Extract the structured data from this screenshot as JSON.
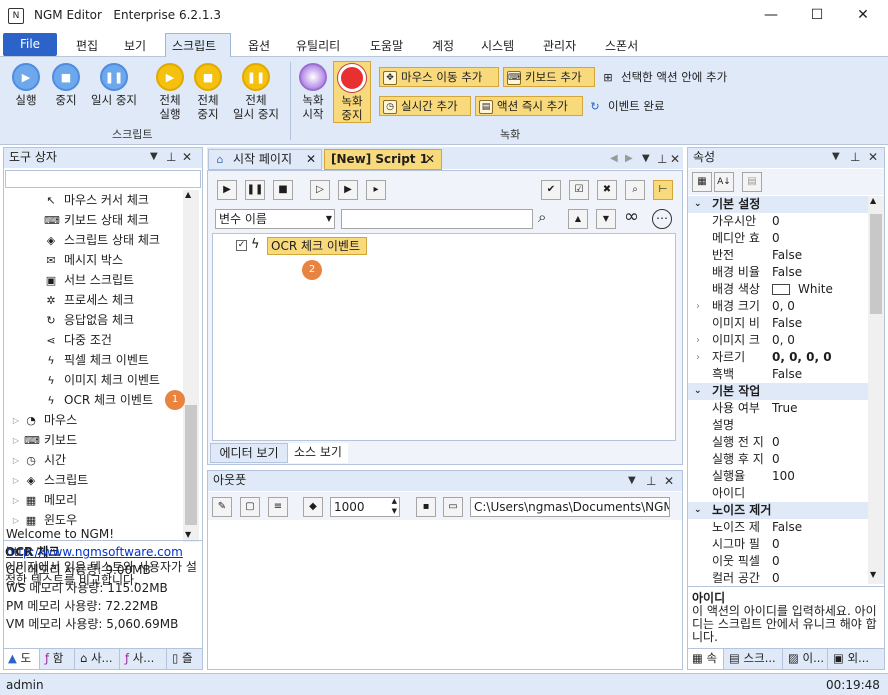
{
  "window": {
    "app_name": "NGM Editor",
    "edition": "Enterprise 6.2.1.3",
    "logo_glyph": "N",
    "minimize_glyph": "—",
    "maximize_glyph": "☐",
    "close_glyph": "✕"
  },
  "menu": {
    "file": "File",
    "items": [
      "편집",
      "보기",
      "스크립트",
      "옵션",
      "유틸리티",
      "도움말",
      "계정",
      "시스템",
      "관리자",
      "스폰서"
    ]
  },
  "ribbon": {
    "run": "실행",
    "stop": "중지",
    "pause": "일시 중지",
    "run_all": [
      "전체",
      "실행"
    ],
    "stop_all": [
      "전체",
      "중지"
    ],
    "pause_all": [
      "전체",
      "일시 중지"
    ],
    "script_group": "스크립트",
    "rec_start": [
      "녹화",
      "시작"
    ],
    "rec_stop": [
      "녹화",
      "중지"
    ],
    "add_mouse": "마우스 이동 추가",
    "add_key": "키보드 추가",
    "add_in_action": "선택한 액션 안에 추가",
    "add_realtime": "실시간 추가",
    "add_immediate": "액션 즉시 추가",
    "event_done": "이벤트 완료",
    "record_group": "녹화"
  },
  "toolbox": {
    "title": "도구 상자",
    "items": [
      {
        "icon": "cursor-check-icon",
        "glyph": "↖",
        "label": "마우스 커서 체크"
      },
      {
        "icon": "keyboard-icon",
        "glyph": "⌨",
        "label": "키보드 상태 체크"
      },
      {
        "icon": "script-status-icon",
        "glyph": "◈",
        "label": "스크립트 상태 체크"
      },
      {
        "icon": "message-icon",
        "glyph": "✉",
        "label": "메시지 박스"
      },
      {
        "icon": "sub-script-icon",
        "glyph": "▣",
        "label": "서브 스크립트"
      },
      {
        "icon": "process-icon",
        "glyph": "✲",
        "label": "프로세스 체크"
      },
      {
        "icon": "refresh-icon",
        "glyph": "↻",
        "label": "응답없음 체크"
      },
      {
        "icon": "share-icon",
        "glyph": "⋖",
        "label": "다중 조건"
      },
      {
        "icon": "lightning-icon",
        "glyph": "ϟ",
        "label": "픽셀 체크 이벤트"
      },
      {
        "icon": "lightning-icon",
        "glyph": "ϟ",
        "label": "이미지 체크 이벤트"
      },
      {
        "icon": "lightning-icon",
        "glyph": "ϟ",
        "label": "OCR 체크 이벤트"
      }
    ],
    "categories": [
      {
        "icon": "mouse-icon",
        "glyph": "◔",
        "label": "마우스"
      },
      {
        "icon": "keyboard-icon",
        "glyph": "⌨",
        "label": "키보드"
      },
      {
        "icon": "clock-icon",
        "glyph": "◷",
        "label": "시간"
      },
      {
        "icon": "script-icon",
        "glyph": "◈",
        "label": "스크립트"
      },
      {
        "icon": "memory-icon",
        "glyph": "▦",
        "label": "메모리"
      },
      {
        "icon": "windows-icon",
        "glyph": "▦",
        "label": "윈도우"
      }
    ],
    "desc_title": "OCR 체크",
    "desc_text": "이미지에서 읽은 텍스트와 사용자가 설정한 텍스트를 비교합니다.",
    "bottom_tabs": [
      "도",
      "함",
      "사...",
      "사...",
      "즐"
    ],
    "badge": "1"
  },
  "editor": {
    "tabs": [
      {
        "label": "시작 페이지"
      },
      {
        "label": "[New] Script 1"
      }
    ],
    "var_select": "변수 이름",
    "event_label": "OCR 체크 이벤트",
    "badge": "2",
    "bottom_tabs": [
      "에디터 보기",
      "소스 보기"
    ]
  },
  "output": {
    "title": "아웃풋",
    "font_size": "1000",
    "path": "C:\\Users\\ngmas\\Documents\\NGM6\\",
    "lines": [
      "Welcome to NGM!",
      "http://www.ngmsoftware.com",
      "GC 메모리 사용량: 9.00MB",
      "WS 메모리 사용량: 115.02MB",
      "PM 메모리 사용량: 72.22MB",
      "VM 메모리 사용량: 5,060.69MB"
    ]
  },
  "properties": {
    "title": "속성",
    "rows": [
      {
        "type": "section",
        "key": "기본 설정"
      },
      {
        "key": "가우시안",
        "val": "0"
      },
      {
        "key": "메디안 효",
        "val": "0"
      },
      {
        "key": "반전",
        "val": "False"
      },
      {
        "key": "배경 비율",
        "val": "False"
      },
      {
        "key": "배경 색상",
        "val": "White",
        "swatch": "#ffffff"
      },
      {
        "key": "배경 크기",
        "val": "0, 0",
        "exp": true
      },
      {
        "key": "이미지 비",
        "val": "False"
      },
      {
        "key": "이미지 크",
        "val": "0, 0",
        "exp": true
      },
      {
        "key": "자르기",
        "val": "0, 0, 0, 0",
        "exp": true,
        "bold": true
      },
      {
        "key": "흑백",
        "val": "False"
      },
      {
        "type": "section",
        "key": "기본 작업"
      },
      {
        "key": "사용 여부",
        "val": "True"
      },
      {
        "key": "설명",
        "val": ""
      },
      {
        "key": "실행 전 지",
        "val": "0"
      },
      {
        "key": "실행 후 지",
        "val": "0"
      },
      {
        "key": "실행율",
        "val": "100"
      },
      {
        "key": "아이디",
        "val": ""
      },
      {
        "type": "section",
        "key": "노이즈 제거"
      },
      {
        "key": "노이즈 제",
        "val": "False"
      },
      {
        "key": "시그마 필",
        "val": "0"
      },
      {
        "key": "이웃 픽셀",
        "val": "0"
      },
      {
        "key": "컬러 공간",
        "val": "0"
      }
    ],
    "desc_title": "아이디",
    "desc_text": "이 액션의 아이디를 입력하세요. 아이디는 스크립트 안에서 유니크 해야 합니다.",
    "bottom_tabs": [
      "속",
      "스크...",
      "이...",
      "외..."
    ]
  },
  "status": {
    "user": "admin",
    "time": "00:19:48"
  },
  "colors": {
    "accent": "#2c63c9",
    "ribbon_bg": "#dfe9f7",
    "highlight": "#f8d97c",
    "badge": "#e8843f"
  }
}
